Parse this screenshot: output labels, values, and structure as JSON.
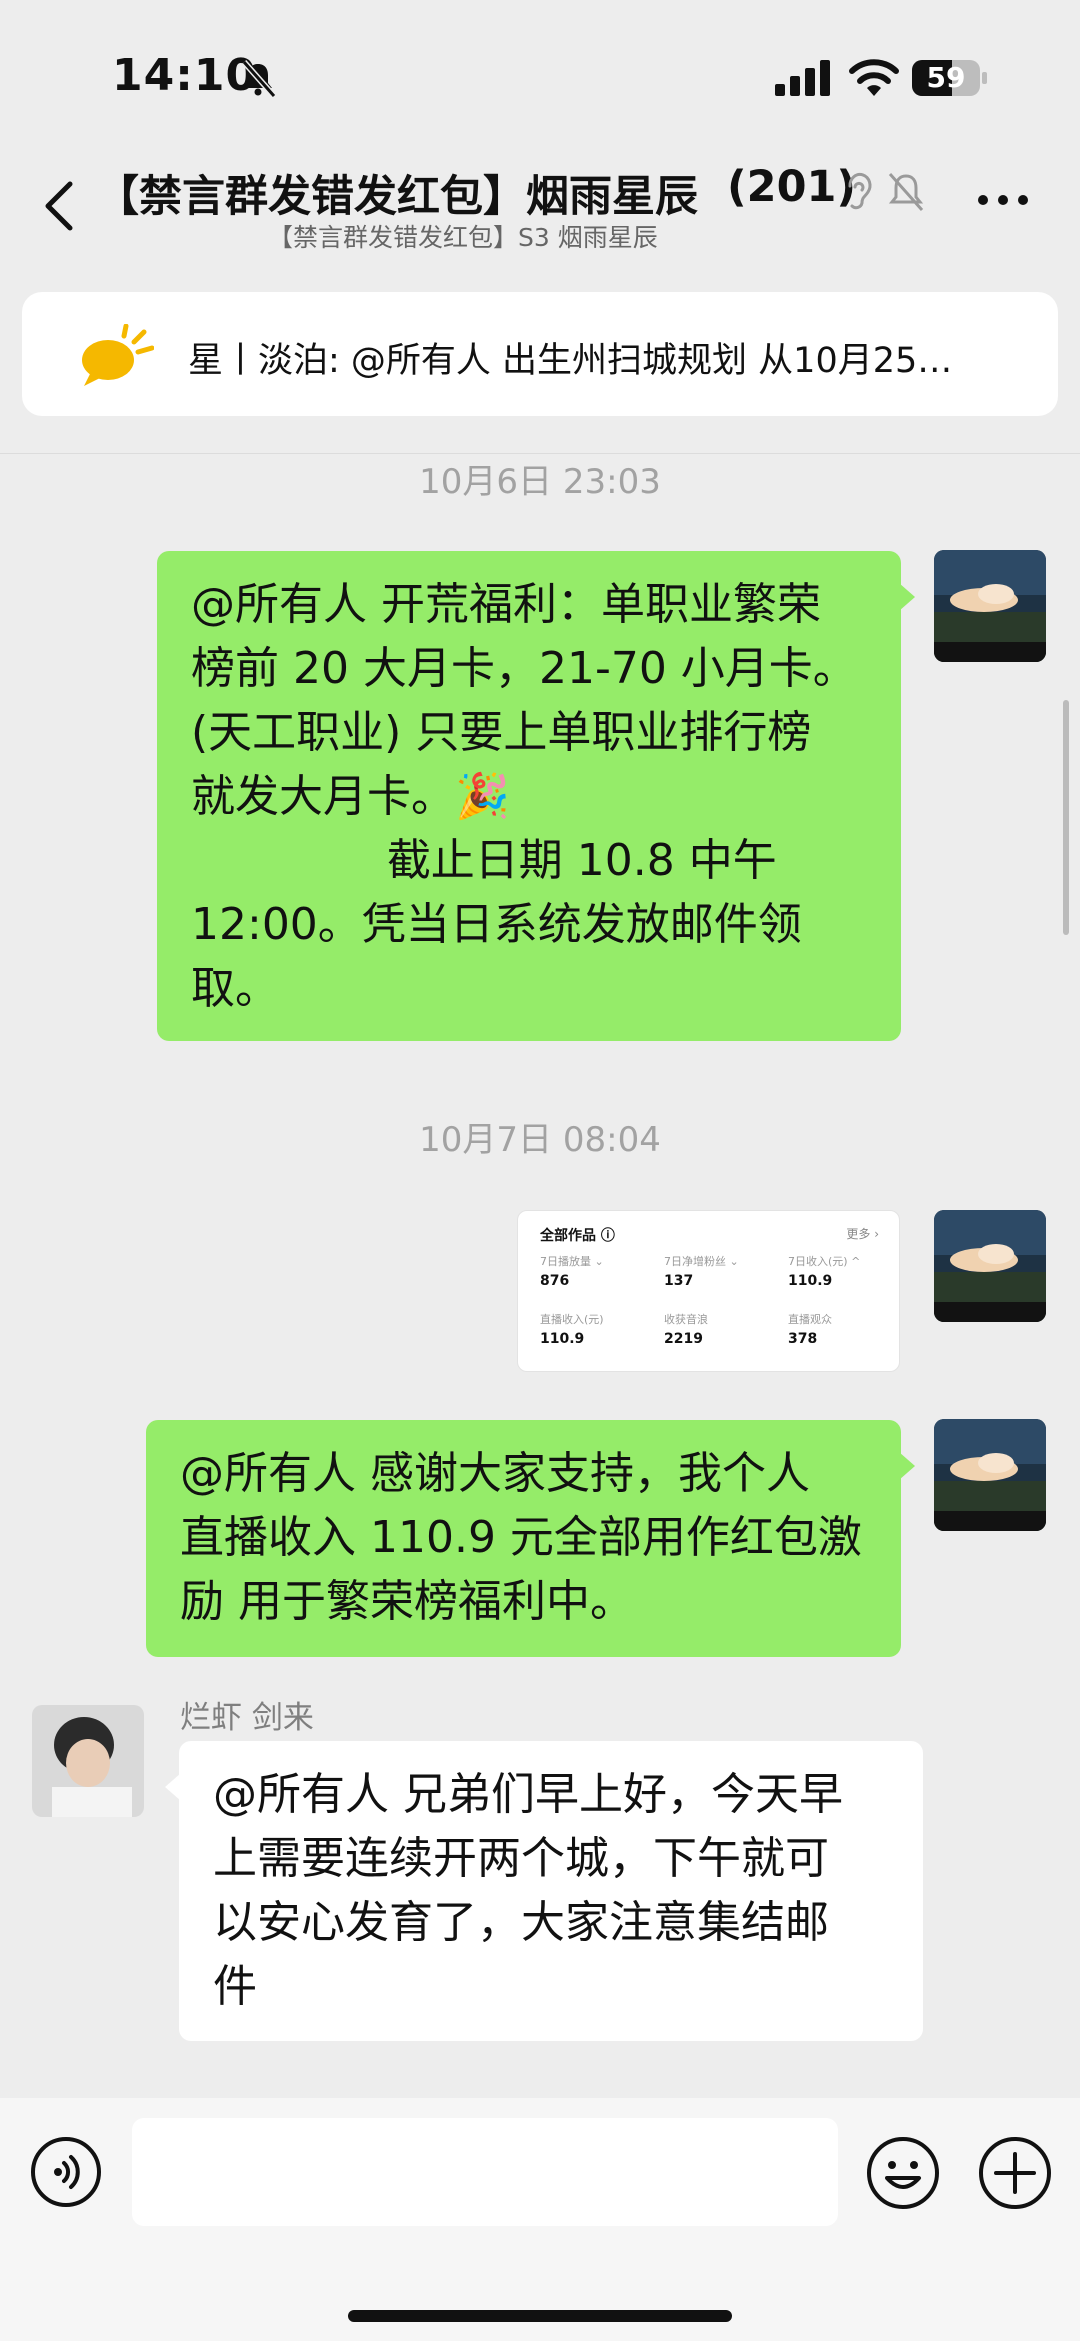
{
  "status": {
    "time": "14:10",
    "battery": "59",
    "battery_level": 0.59
  },
  "nav": {
    "title": "【禁言群发错发红包】烟雨星辰",
    "count": "(201)",
    "subtitle": "【禁言群发错发红包】S3 烟雨星辰"
  },
  "pinned": {
    "text": "星丨淡泊: @所有人 出生州扫城规划 从10月25…"
  },
  "messages": {
    "ts1": "10月6日 23:03",
    "msg1": "@所有人 开荒福利：单职业繁荣\n榜前 20 大月卡，21-70 小月卡。\n(天工职业) 只要上单职业排行榜\n就发大月卡。🎉\n              截止日期 10.8 中午\n12:00。凭当日系统发放邮件领\n取。",
    "ts2": "10月7日 08:04",
    "msg3": "@所有人 感谢大家支持，我个人\n直播收入 110.9 元全部用作红包激\n励 用于繁荣榜福利中。",
    "sender": "烂虾 剑来",
    "msg4": "@所有人 兄弟们早上好，今天早\n上需要连续开两个城，下午就可\n以安心发育了，大家注意集结邮\n件"
  },
  "card": {
    "header": "全部作品 ⓘ",
    "more": "更多 ›",
    "cells": [
      {
        "label": "7日播放量 ⌄",
        "value": "876"
      },
      {
        "label": "7日净增粉丝 ⌄",
        "value": "137"
      },
      {
        "label": "7日收入(元) ^",
        "value": "110.9"
      },
      {
        "label": "直播收入(元)",
        "value": "110.9"
      },
      {
        "label": "收获音浪",
        "value": "2219"
      },
      {
        "label": "直播观众",
        "value": "378"
      }
    ]
  },
  "icons": {
    "back": "chevron-left-icon",
    "more": "more-dots-icon",
    "pinned": "megaphone-icon",
    "voice": "voice-icon",
    "emoji": "emoji-icon",
    "plus": "plus-icon"
  },
  "colors": {
    "bubble_green": "#95ec69",
    "background": "#ededed",
    "pinned_yellow": "#f5b800"
  }
}
